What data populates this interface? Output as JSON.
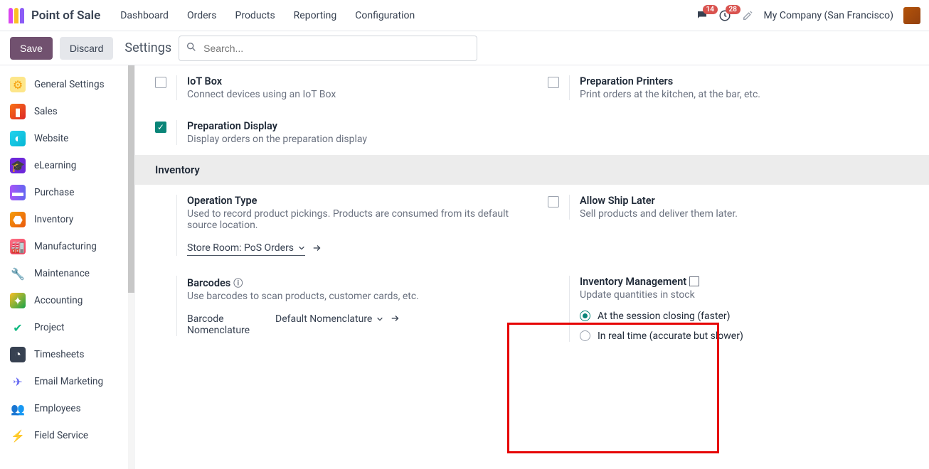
{
  "header": {
    "app_name": "Point of Sale",
    "nav": [
      "Dashboard",
      "Orders",
      "Products",
      "Reporting",
      "Configuration"
    ],
    "chat_badge": "14",
    "activity_badge": "28",
    "company": "My Company (San Francisco)"
  },
  "toolbar": {
    "save": "Save",
    "discard": "Discard",
    "crumb": "Settings",
    "search_placeholder": "Search..."
  },
  "sidebar": {
    "items": [
      {
        "label": "General Settings",
        "icon": "⚙",
        "color": "#f59e0b",
        "bg": "#fde68a"
      },
      {
        "label": "Sales",
        "icon": "▮",
        "color": "#fff",
        "bg": "linear-gradient(135deg,#f97316,#dc2626)"
      },
      {
        "label": "Website",
        "icon": "◐",
        "color": "#fff",
        "bg": "linear-gradient(135deg,#22d3ee,#06b6d4)"
      },
      {
        "label": "eLearning",
        "icon": "🎓",
        "color": "#fff",
        "bg": "#6d28d9"
      },
      {
        "label": "Purchase",
        "icon": "▬",
        "color": "#fff",
        "bg": "linear-gradient(90deg,#a855f7,#6366f1)"
      },
      {
        "label": "Inventory",
        "icon": "⬣",
        "color": "#fff",
        "bg": "linear-gradient(135deg,#f59e0b,#ea580c)"
      },
      {
        "label": "Manufacturing",
        "icon": "🏭",
        "color": "#fff",
        "bg": "linear-gradient(135deg,#fb7185,#f43f5e)"
      },
      {
        "label": "Maintenance",
        "icon": "🔧",
        "color": "#2563eb",
        "bg": "transparent"
      },
      {
        "label": "Accounting",
        "icon": "✦",
        "color": "#fff",
        "bg": "linear-gradient(135deg,#fbbf24,#16a34a)"
      },
      {
        "label": "Project",
        "icon": "✔",
        "color": "#10b981",
        "bg": "transparent"
      },
      {
        "label": "Timesheets",
        "icon": "◔",
        "color": "#fff",
        "bg": "#374151"
      },
      {
        "label": "Email Marketing",
        "icon": "✈",
        "color": "#6366f1",
        "bg": "transparent"
      },
      {
        "label": "Employees",
        "icon": "👥",
        "color": "#78350f",
        "bg": "transparent"
      },
      {
        "label": "Field Service",
        "icon": "⚡",
        "color": "#f59e0b",
        "bg": "transparent"
      }
    ]
  },
  "settings": {
    "iot": {
      "title": "IoT Box",
      "desc": "Connect devices using an IoT Box"
    },
    "printers": {
      "title": "Preparation Printers",
      "desc": "Print orders at the kitchen, at the bar, etc."
    },
    "prep_display": {
      "title": "Preparation Display",
      "desc": "Display orders on the preparation display"
    },
    "section_inventory": "Inventory",
    "op_type": {
      "title": "Operation Type",
      "desc": "Used to record product pickings. Products are consumed from its default source location.",
      "value": "Store Room: PoS Orders"
    },
    "ship_later": {
      "title": "Allow Ship Later",
      "desc": "Sell products and deliver them later."
    },
    "barcodes": {
      "title": "Barcodes",
      "desc": "Use barcodes to scan products, customer cards, etc.",
      "field_label": "Barcode Nomenclature",
      "value": "Default Nomenclature"
    },
    "inv_mgmt": {
      "title": "Inventory Management",
      "desc": "Update quantities in stock",
      "opt1": "At the session closing (faster)",
      "opt2": "In real time (accurate but slower)"
    }
  }
}
